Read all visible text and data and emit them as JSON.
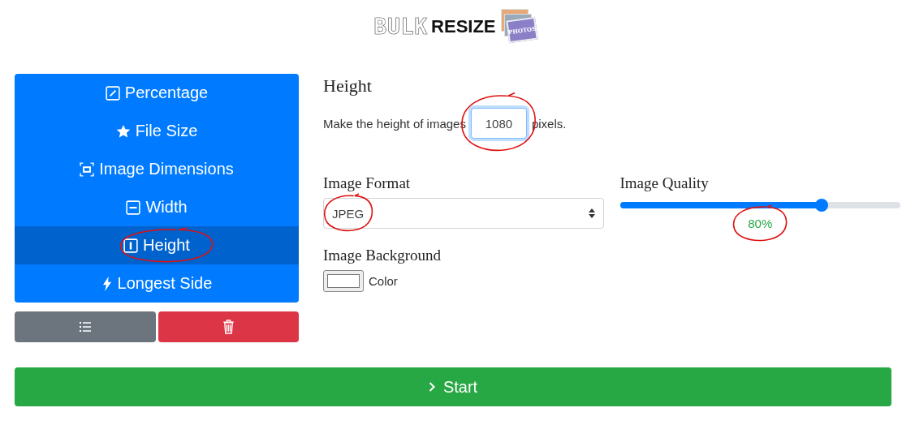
{
  "logo": {
    "word_1": "BULK",
    "word_2": "RESIZE",
    "badge": "PHOTOS"
  },
  "menu": [
    {
      "label": "Percentage",
      "kind": "pencil",
      "selected": false,
      "circled": false
    },
    {
      "label": "File Size",
      "kind": "star",
      "selected": false,
      "circled": false
    },
    {
      "label": "Image Dimensions",
      "kind": "corners",
      "selected": false,
      "circled": false
    },
    {
      "label": "Width",
      "kind": "dash",
      "selected": false,
      "circled": false
    },
    {
      "label": "Height",
      "kind": "bar",
      "selected": true,
      "circled": true
    },
    {
      "label": "Longest Side",
      "kind": "bolt",
      "selected": false,
      "circled": false
    }
  ],
  "actions": [
    {
      "kind": "list"
    },
    {
      "kind": "delete"
    }
  ],
  "section": {
    "title": "Height",
    "text_before": "Make the height of images",
    "value": "1080",
    "text_after": "pixels.",
    "circled": true
  },
  "format": {
    "label": "Image Format",
    "value": "JPEG",
    "circled": true
  },
  "quality": {
    "label": "Image Quality",
    "level": 0.72,
    "reading": "80%",
    "circled": true
  },
  "background": {
    "label": "Image Background",
    "text": "Color"
  },
  "start": {
    "label": "Start"
  }
}
